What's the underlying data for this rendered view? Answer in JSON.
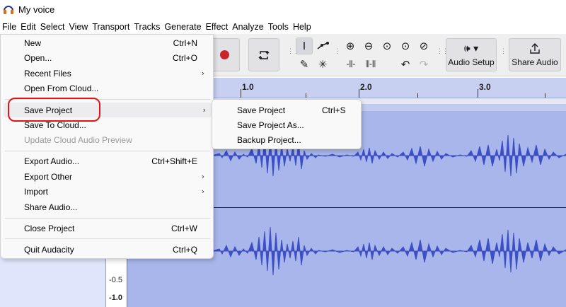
{
  "window": {
    "title": "My voice"
  },
  "menubar": [
    "File",
    "Edit",
    "Select",
    "View",
    "Transport",
    "Tracks",
    "Generate",
    "Effect",
    "Analyze",
    "Tools",
    "Help"
  ],
  "toolbar": {
    "audio_setup_label": "Audio Setup",
    "share_audio_label": "Share Audio",
    "icons": [
      "record-icon",
      "loop-icon",
      "selection-tool-icon",
      "envelope-tool-icon",
      "draw-tool-icon",
      "multi-tool-icon",
      "zoom-in-icon",
      "zoom-out-icon",
      "fit-selection-icon",
      "fit-project-icon",
      "zoom-toggle-icon",
      "trim-icon",
      "silence-icon",
      "undo-icon",
      "redo-icon",
      "speaker-icon",
      "share-icon"
    ]
  },
  "ruler": {
    "labels": [
      "1.0",
      "2.0",
      "3.0"
    ]
  },
  "track": {
    "scale_labels": [
      "-0.5",
      "-1.0"
    ]
  },
  "file_menu": {
    "items": [
      {
        "label": "New",
        "shortcut": "Ctrl+N"
      },
      {
        "label": "Open...",
        "shortcut": "Ctrl+O"
      },
      {
        "label": "Recent Files",
        "submenu": true
      },
      {
        "label": "Open From Cloud..."
      },
      {
        "label": "Save Project",
        "submenu": true,
        "highlighted": true
      },
      {
        "label": "Save To Cloud..."
      },
      {
        "label": "Update Cloud Audio Preview",
        "disabled": true
      },
      {
        "label": "Export Audio...",
        "shortcut": "Ctrl+Shift+E"
      },
      {
        "label": "Export Other",
        "submenu": true
      },
      {
        "label": "Import",
        "submenu": true
      },
      {
        "label": "Share Audio..."
      },
      {
        "label": "Close Project",
        "shortcut": "Ctrl+W"
      },
      {
        "label": "Quit Audacity",
        "shortcut": "Ctrl+Q"
      }
    ]
  },
  "save_submenu": {
    "items": [
      {
        "label": "Save Project",
        "shortcut": "Ctrl+S"
      },
      {
        "label": "Save Project As..."
      },
      {
        "label": "Backup Project..."
      }
    ]
  },
  "colors": {
    "annotation_ring": "#e0141a",
    "waveform": "#3d4fc4",
    "clip_background": "#a8b6eb"
  }
}
